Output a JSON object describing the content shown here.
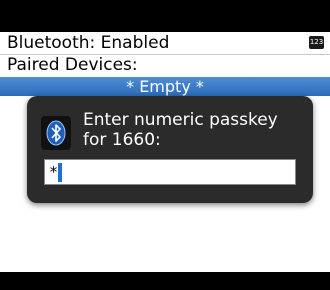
{
  "screen": {
    "title": "Bluetooth: Enabled",
    "input_mode_badge": "123",
    "paired_devices_label": "Paired Devices:",
    "paired_devices_list": [
      "* Empty *"
    ]
  },
  "dialog": {
    "prompt": "Enter numeric passkey for 1660:",
    "icon": "bluetooth-icon",
    "passkey_value": "*"
  },
  "colors": {
    "selection": "#3a7ec8",
    "dialog_bg": "#2b2b2b",
    "caret": "#1f6fd6"
  }
}
